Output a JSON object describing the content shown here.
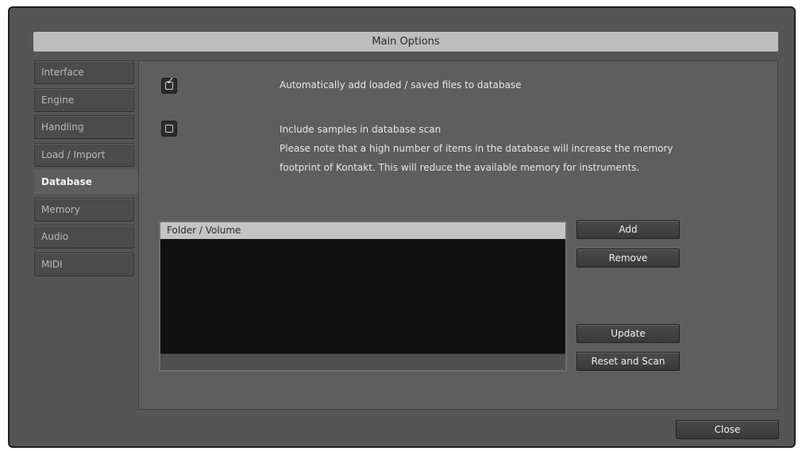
{
  "window": {
    "title": "Main Options"
  },
  "sidebar": {
    "tabs": [
      {
        "label": "Interface"
      },
      {
        "label": "Engine"
      },
      {
        "label": "Handling"
      },
      {
        "label": "Load / Import"
      },
      {
        "label": "Database"
      },
      {
        "label": "Memory"
      },
      {
        "label": "Audio"
      },
      {
        "label": "MIDI"
      }
    ],
    "active": "Database"
  },
  "database": {
    "auto_add": {
      "label": "Automatically add loaded / saved files to database",
      "checked": true
    },
    "include_samples": {
      "label": "Include samples in database scan",
      "checked": false,
      "note_line1": "Please note that a high number of items in the database will increase the memory",
      "note_line2": "footprint of Kontakt. This will reduce the available memory for instruments."
    },
    "list": {
      "header": "Folder / Volume",
      "items": []
    },
    "buttons": {
      "add": "Add",
      "remove": "Remove",
      "update": "Update",
      "reset_scan": "Reset and Scan"
    }
  },
  "footer": {
    "close": "Close"
  }
}
